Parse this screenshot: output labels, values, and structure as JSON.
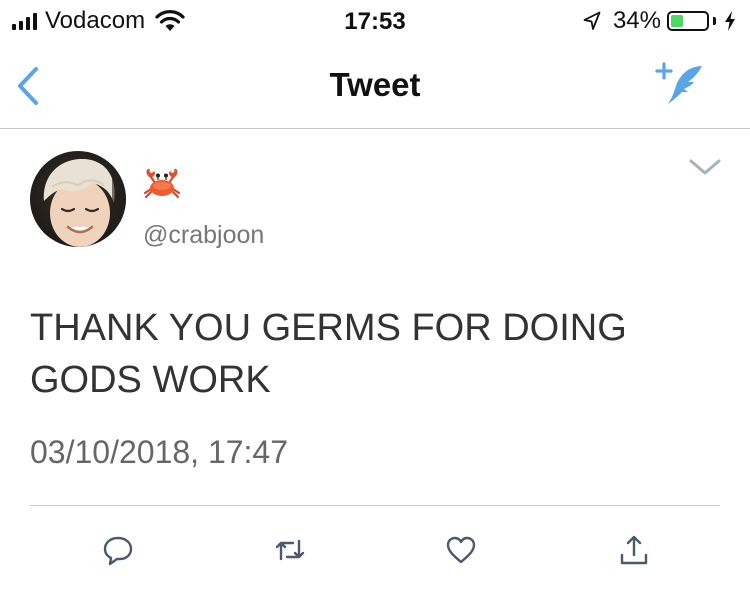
{
  "status_bar": {
    "carrier": "Vodacom",
    "time": "17:53",
    "battery_percent_label": "34%",
    "battery_level": 0.34
  },
  "nav": {
    "title": "Tweet"
  },
  "tweet": {
    "display_name_emoji": "crab-emoji",
    "handle": "@crabjoon",
    "text": "THANK YOU GERMS FOR DOING GODS WORK",
    "timestamp": "03/10/2018, 17:47"
  },
  "icons": {
    "back": "chevron-left-icon",
    "compose": "compose-tweet-icon",
    "menu": "chevron-down-icon",
    "reply": "reply-icon",
    "retweet": "retweet-icon",
    "like": "heart-icon",
    "share": "share-icon"
  },
  "colors": {
    "accent": "#5ba4e6",
    "text": "#111111",
    "secondary_text": "#777777",
    "icon_gray": "#8899a6",
    "battery_green": "#4cd964"
  }
}
